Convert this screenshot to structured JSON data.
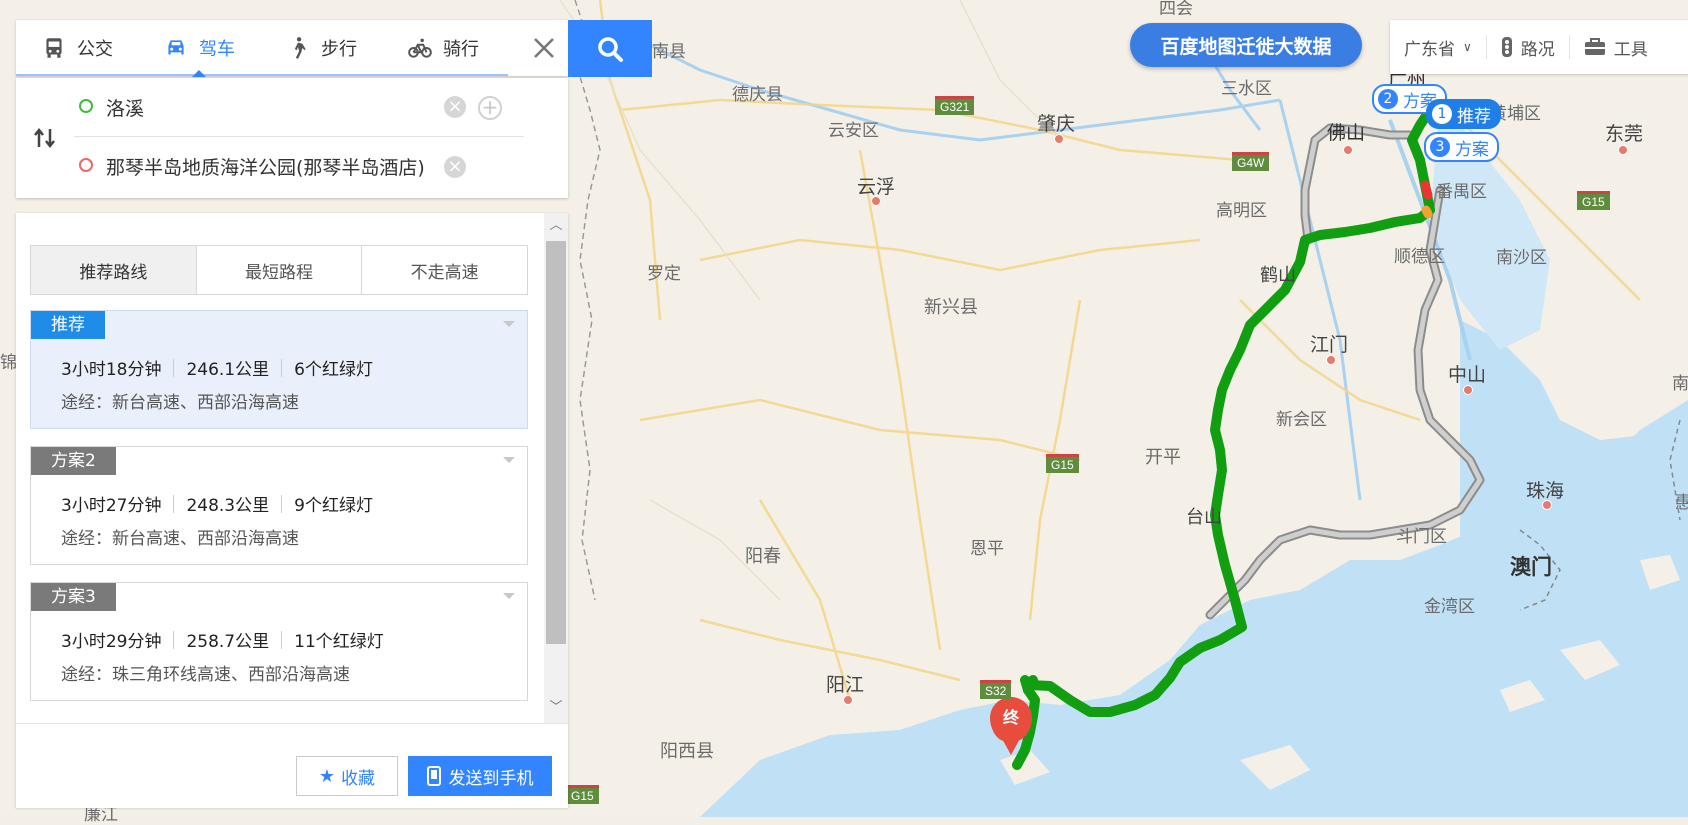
{
  "modes": [
    {
      "label": "公交",
      "icon": "bus-icon"
    },
    {
      "label": "驾车",
      "icon": "car-icon",
      "active": true
    },
    {
      "label": "步行",
      "icon": "walk-icon"
    },
    {
      "label": "骑行",
      "icon": "bike-icon"
    }
  ],
  "route": {
    "origin": "洛溪",
    "destination": "那琴半岛地质海洋公园(那琴半岛酒店)"
  },
  "plan_tabs": [
    "推荐路线",
    "最短路程",
    "不走高速"
  ],
  "plans": [
    {
      "tag": "推荐",
      "time": "3小时18分钟",
      "distance": "246.1公里",
      "lights": "6个红绿灯",
      "via": "途经：新台高速、西部沿海高速"
    },
    {
      "tag": "方案2",
      "time": "3小时27分钟",
      "distance": "248.3公里",
      "lights": "9个红绿灯",
      "via": "途经：新台高速、西部沿海高速"
    },
    {
      "tag": "方案3",
      "time": "3小时29分钟",
      "distance": "258.7公里",
      "lights": "11个红绿灯",
      "via": "途经：珠三角环线高速、西部沿海高速"
    }
  ],
  "footer": {
    "favorite": "收藏",
    "send": "发送到手机"
  },
  "migration_label": "百度地图迁徙大数据",
  "toolbar": {
    "province": "广东省",
    "traffic": "路况",
    "tools": "工具"
  },
  "callouts": {
    "c1": "推荐",
    "c1_num": "1",
    "c2": "方案",
    "c2_num": "2",
    "c3": "方案",
    "c3_num": "3"
  },
  "map_labels": {
    "guangzhou": "广州",
    "sihui": "四会",
    "sanshui": "三水区",
    "foshan": "佛山",
    "panyu": "番禺区",
    "dongguan": "东莞",
    "nansha": "南沙区",
    "shunde": "顺德区",
    "gaoming": "高明区",
    "heshan": "鹤山",
    "jiangmen": "江门",
    "zhongshan": "中山",
    "xinhui": "新会区",
    "kaiping": "开平",
    "taishan": "台山",
    "doumen": "斗门区",
    "zhuhai": "珠海",
    "macau": "澳门",
    "jinwan": "金湾区",
    "enping": "恩平",
    "yangchun": "阳春",
    "yangjiang": "阳江",
    "yangxi": "阳西县",
    "zhaoqing": "肇庆",
    "deqing": "德庆县",
    "yunan": "云安区",
    "yunfu": "云浮",
    "luoding": "罗定",
    "xinxing": "新兴县",
    "fengkai": "南县",
    "huangpu": "黄埔区",
    "huangtu": "廉江",
    "nan": "南",
    "jin": "锦",
    "hui": "惠"
  },
  "shields": {
    "g321": "G321",
    "g4w": "G4W",
    "g15a": "G15",
    "g15b": "G15",
    "g15c": "G15",
    "s32": "S32"
  },
  "dest_marker": "终"
}
